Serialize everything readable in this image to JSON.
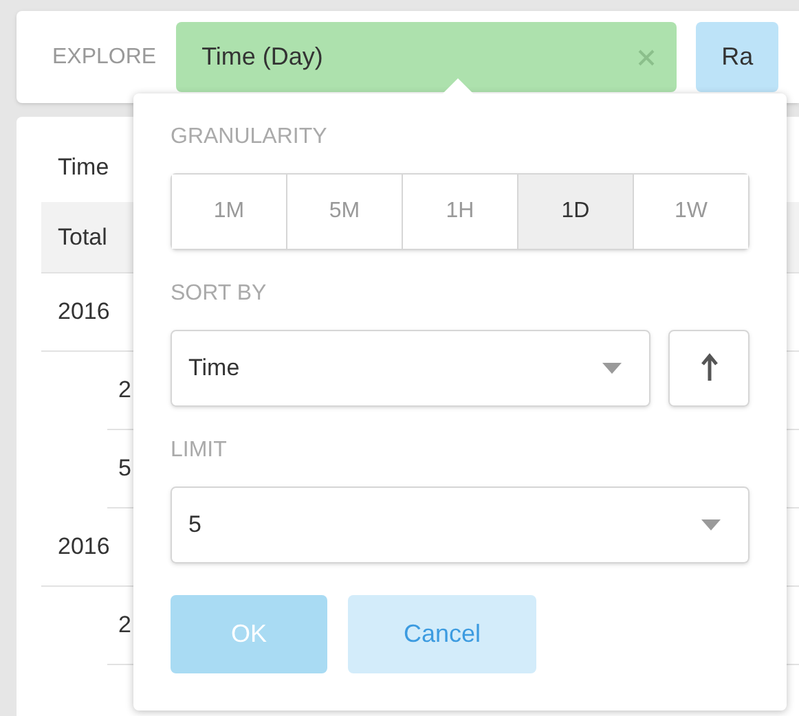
{
  "explore_bar": {
    "label": "EXPLORE",
    "pills": [
      {
        "label": "Time (Day)",
        "color": "#ade1ad",
        "removable": true
      },
      {
        "label": "Ra",
        "color": "#bde3f8",
        "removable": false
      }
    ]
  },
  "table": {
    "header": "Time",
    "rows": [
      {
        "kind": "total",
        "label": "Total"
      },
      {
        "kind": "group",
        "label": "2016"
      },
      {
        "kind": "item",
        "label": "2"
      },
      {
        "kind": "item",
        "label": "5"
      },
      {
        "kind": "group",
        "label": "2016"
      },
      {
        "kind": "item",
        "label": "2"
      }
    ]
  },
  "popover": {
    "granularity": {
      "title": "GRANULARITY",
      "options": [
        {
          "label": "1M",
          "selected": false
        },
        {
          "label": "5M",
          "selected": false
        },
        {
          "label": "1H",
          "selected": false
        },
        {
          "label": "1D",
          "selected": true
        },
        {
          "label": "1W",
          "selected": false
        }
      ]
    },
    "sort_by": {
      "title": "SORT BY",
      "value": "Time",
      "ascending": true
    },
    "limit": {
      "title": "LIMIT",
      "value": "5"
    },
    "buttons": [
      {
        "label": "OK",
        "kind": "primary"
      },
      {
        "label": "Cancel",
        "kind": "secondary"
      }
    ]
  }
}
